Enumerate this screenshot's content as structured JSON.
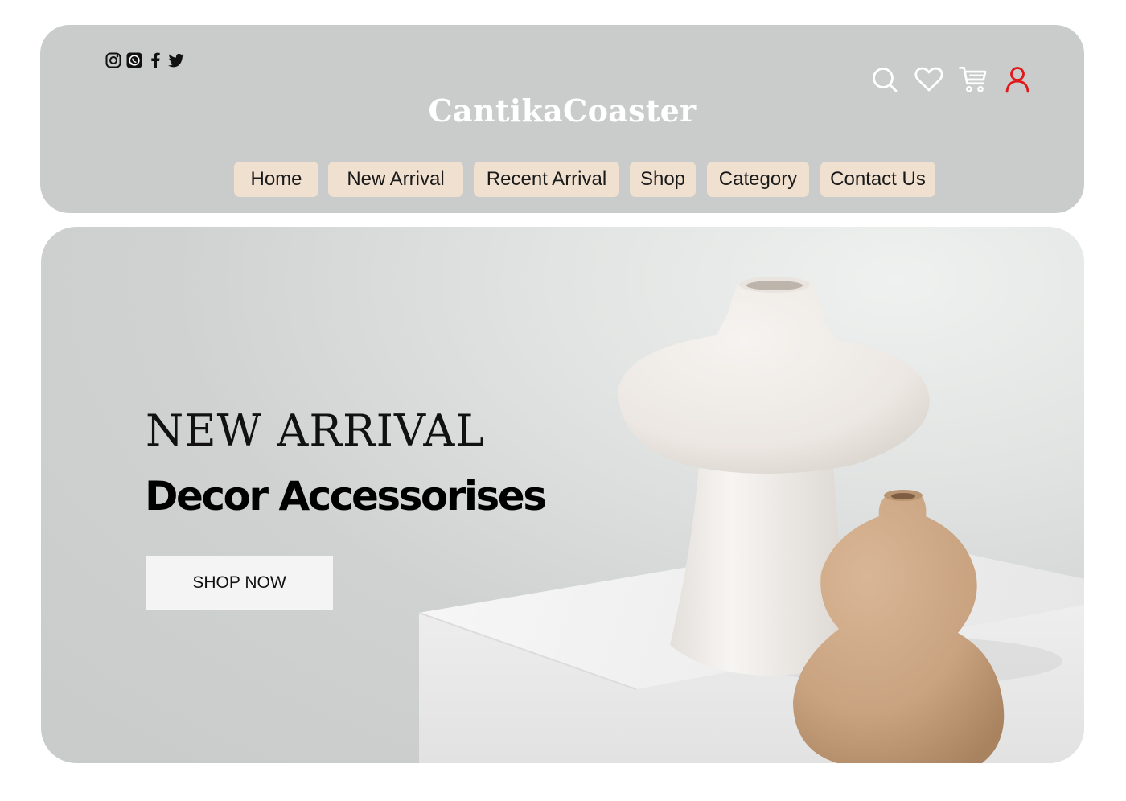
{
  "brand": {
    "name": "CantikaCoaster",
    "text_color": "#ffffff",
    "header_bg": "#cacccb"
  },
  "social": [
    {
      "icon": "instagram-icon"
    },
    {
      "icon": "whatsapp-icon"
    },
    {
      "icon": "facebook-icon"
    },
    {
      "icon": "twitter-icon"
    }
  ],
  "header_actions": [
    {
      "icon": "search-icon",
      "color": "#ffffff"
    },
    {
      "icon": "heart-icon",
      "color": "#ffffff"
    },
    {
      "icon": "cart-icon",
      "color": "#ffffff"
    },
    {
      "icon": "user-icon",
      "color": "#e0191b"
    }
  ],
  "nav": {
    "items": [
      {
        "label": "Home"
      },
      {
        "label": "New Arrival"
      },
      {
        "label": "Recent Arrival"
      },
      {
        "label": "Shop"
      },
      {
        "label": "Category"
      },
      {
        "label": "Contact Us"
      }
    ],
    "item_bg": "#f0e0cf"
  },
  "hero": {
    "eyebrow": "NEW ARRIVAL",
    "title": "Decor Accessorises",
    "cta_label": "SHOP NOW"
  }
}
